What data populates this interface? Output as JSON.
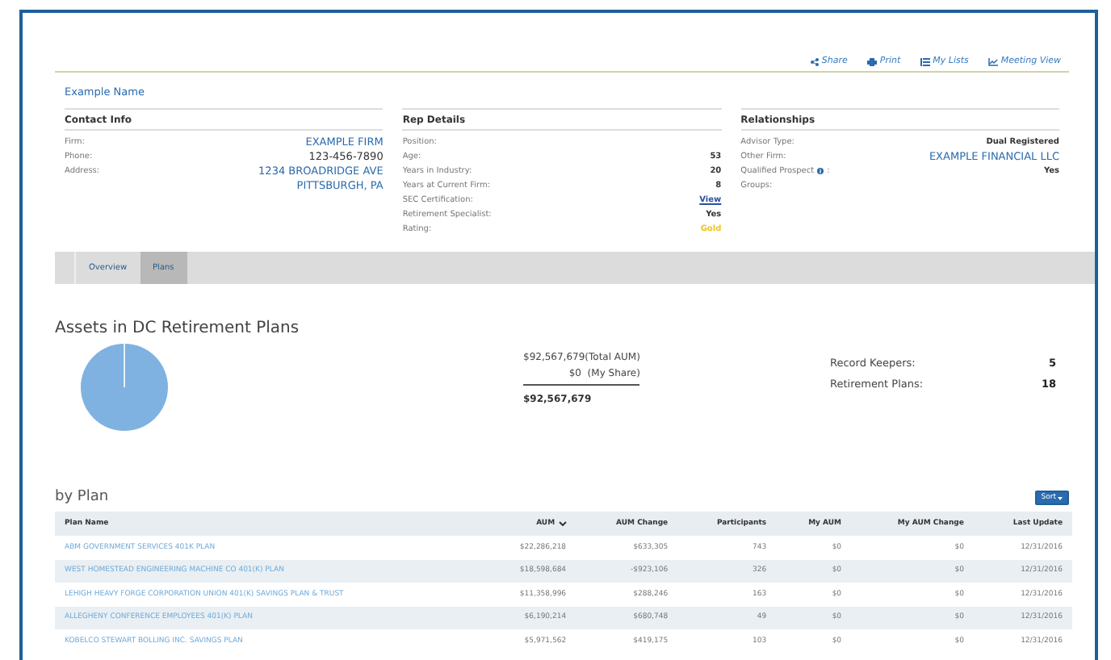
{
  "toolbar": [
    {
      "label": "Share"
    },
    {
      "label": "Print"
    },
    {
      "label": "My Lists"
    },
    {
      "label": "Meeting View"
    }
  ],
  "name": "Example Name",
  "sections": [
    {
      "title": "Contact Info",
      "rows": [
        {
          "label": "Firm:",
          "value": "EXAMPLE FIRM",
          "kind": "link"
        },
        {
          "label": "Phone:",
          "value": "123-456-7890",
          "kind": "large"
        },
        {
          "label": "Address:",
          "value": "1234 BROADRIDGE AVE",
          "kind": "link"
        },
        {
          "value": "PITTSBURGH, PA",
          "kind": "link"
        }
      ]
    },
    {
      "title": "Rep Details",
      "rows": [
        {
          "label": "Position:"
        },
        {
          "label": "Age:",
          "value": "53",
          "kind": "plain"
        },
        {
          "label": "Years in Industry:",
          "value": "20",
          "kind": "plain"
        },
        {
          "label": "Years at Current Firm:",
          "value": "8",
          "kind": "plain"
        },
        {
          "label": "SEC Certification:",
          "value": "View",
          "kind": "underline"
        },
        {
          "label": "Retirement Specialist:",
          "value": "Yes",
          "kind": "plain"
        },
        {
          "label": "Rating:",
          "value": "Gold",
          "kind": "gold"
        }
      ]
    },
    {
      "title": "Relationships",
      "rows": [
        {
          "label": "Advisor Type:",
          "value": "Dual Registered",
          "kind": "plain"
        },
        {
          "label": "Other Firm:",
          "value": "EXAMPLE FINANCIAL LLC",
          "kind": "link"
        },
        {
          "label": "Qualified Prospect",
          "info": true,
          "suffix": ":",
          "value": "Yes",
          "kind": "plain"
        },
        {
          "label": "Groups:"
        }
      ]
    }
  ],
  "tabs": [
    {
      "label": "Overview",
      "selected": false
    },
    {
      "label": "Plans",
      "selected": true
    }
  ],
  "assets": {
    "title": "Assets in DC Retirement Plans",
    "total_line": "$92,567,679(Total AUM)",
    "share_line": "$0  (My Share)",
    "sum": "$92,567,679",
    "stats": [
      {
        "label": "Record Keepers:",
        "value": "5"
      },
      {
        "label": "Retirement Plans:",
        "value": "18"
      }
    ]
  },
  "by_plan": {
    "title": "by Plan",
    "sort_button": "Sort",
    "columns": [
      "Plan Name",
      "AUM",
      "AUM Change",
      "Participants",
      "My AUM",
      "My AUM Change",
      "Last Update"
    ],
    "rows": [
      [
        "ABM GOVERNMENT SERVICES 401K PLAN",
        "$22,286,218",
        "$633,305",
        "743",
        "$0",
        "$0",
        "12/31/2016"
      ],
      [
        "WEST HOMESTEAD ENGINEERING MACHINE CO 401(K) PLAN",
        "$18,598,684",
        "-$923,106",
        "326",
        "$0",
        "$0",
        "12/31/2016"
      ],
      [
        "LEHIGH HEAVY FORGE CORPORATION UNION 401(K) SAVINGS PLAN & TRUST",
        "$11,358,996",
        "$288,246",
        "163",
        "$0",
        "$0",
        "12/31/2016"
      ],
      [
        "ALLEGHENY CONFERENCE EMPLOYEES 401(K) PLAN",
        "$6,190,214",
        "$680,748",
        "49",
        "$0",
        "$0",
        "12/31/2016"
      ],
      [
        "KOBELCO STEWART BOLLING INC. SAVINGS PLAN",
        "$5,971,562",
        "$419,175",
        "103",
        "$0",
        "$0",
        "12/31/2016"
      ]
    ]
  }
}
